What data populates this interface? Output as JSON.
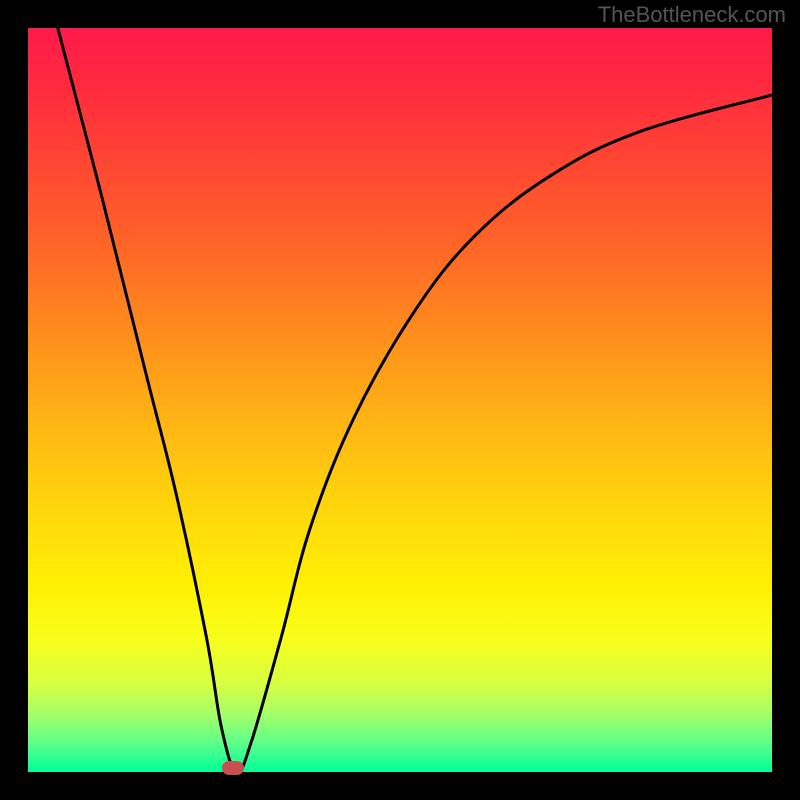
{
  "watermark": "TheBottleneck.com",
  "chart_data": {
    "type": "line",
    "title": "",
    "xlabel": "",
    "ylabel": "",
    "xlim": [
      0,
      100
    ],
    "ylim": [
      0,
      100
    ],
    "series": [
      {
        "name": "curve",
        "x": [
          4,
          10,
          16,
          20,
          24,
          26,
          28,
          30,
          34,
          38,
          44,
          52,
          60,
          70,
          82,
          100
        ],
        "values": [
          100,
          77,
          53,
          37,
          18,
          6,
          0,
          4,
          18,
          33,
          48,
          62,
          72,
          80,
          86,
          91
        ]
      }
    ],
    "marker": {
      "x": 27.5,
      "y": 0.6,
      "shape": "pill",
      "color": "#c94f4f"
    },
    "gradient": {
      "top_color": "#ff1a4a",
      "mid_color": "#ffd50c",
      "bottom_color": "#00ff9a"
    }
  }
}
